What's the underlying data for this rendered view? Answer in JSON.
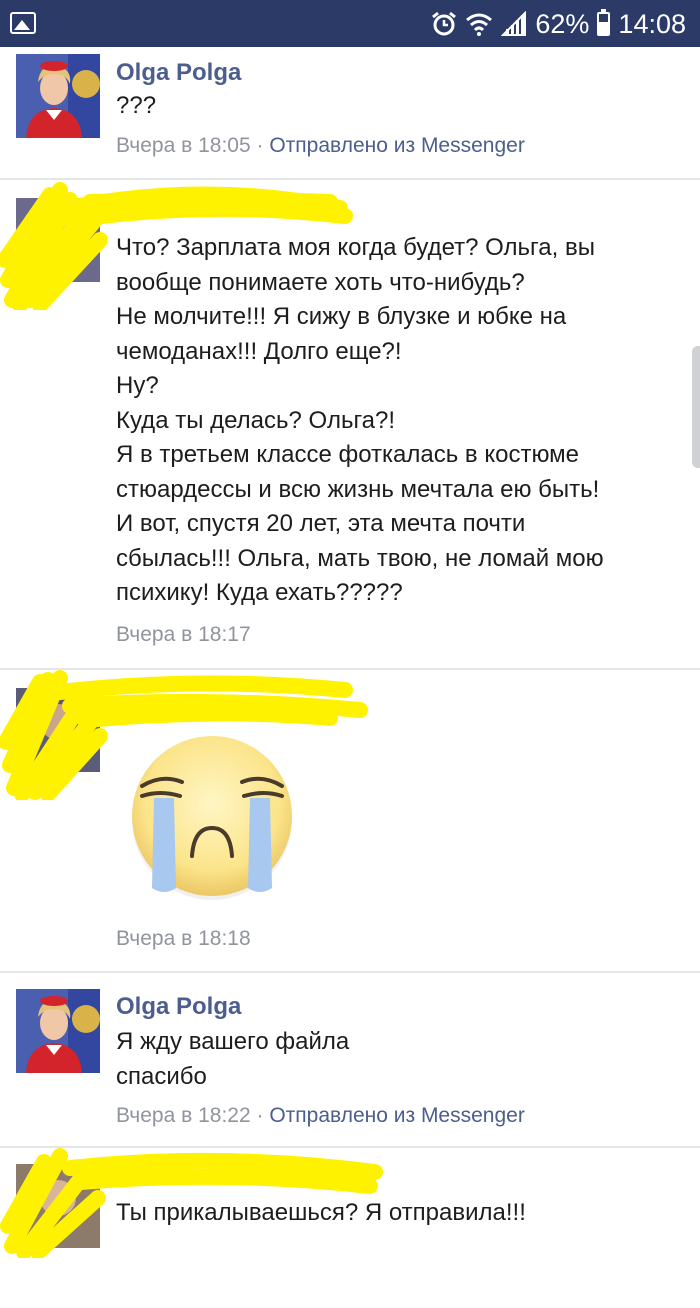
{
  "status_bar": {
    "battery": "62%",
    "time": "14:08",
    "icons": [
      "gallery-icon",
      "alarm-icon",
      "wifi-icon",
      "signal-icon",
      "battery-icon"
    ]
  },
  "colors": {
    "status_bar": "#2b3a67",
    "name": "#4b5e8e",
    "meta": "#90949c",
    "scribble": "#fff200"
  },
  "messages": [
    {
      "name": "Olga Polga",
      "text": "???",
      "time": "Вчера в 18:05",
      "separator": " · ",
      "sent_via": "Отправлено из Messenger"
    },
    {
      "name": "",
      "text": "Что? Зарплата моя когда будет? Ольга, вы\nвообще понимаете хоть что-нибудь?\nНе молчите!!! Я сижу в блузке и юбке на\nчемоданах!!! Долго еще?!\nНу?\nКуда ты делась? Ольга?!\nЯ в третьем классе фоткалась в костюме\nстюардессы и всю жизнь мечтала ею быть!\nИ вот, спустя 20 лет, эта мечта почти\nсбылась!!! Ольга, мать твою, не ломай мою\nпсихику! Куда ехать?????",
      "time": "Вчера в 18:17"
    },
    {
      "name": "",
      "emoji": "crying-face",
      "time": "Вчера в 18:18"
    },
    {
      "name": "Olga Polga",
      "text": "Я жду вашего файла\nспасибо",
      "time": "Вчера в 18:22",
      "separator": " · ",
      "sent_via": "Отправлено из Messenger"
    },
    {
      "name": "",
      "text": "Ты прикалываешься? Я отправила!!!",
      "time": ""
    }
  ]
}
